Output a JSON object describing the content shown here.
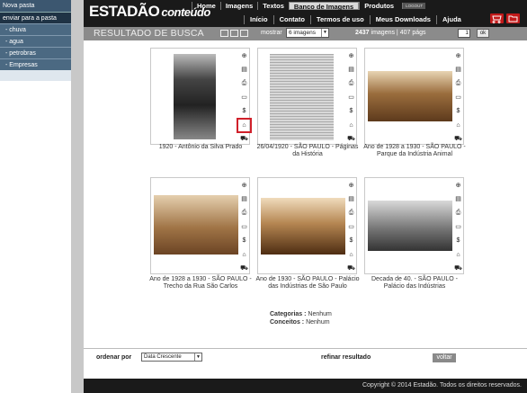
{
  "sidebar": {
    "items": [
      {
        "label": "Nova pasta"
      },
      {
        "label": "enviar para a pasta"
      },
      {
        "label": "- chuva"
      },
      {
        "label": "- agua"
      },
      {
        "label": "- petrobras"
      },
      {
        "label": "- Empresas"
      }
    ]
  },
  "header": {
    "logo": "ESTADÃO",
    "logo_sub": "conteúdo",
    "nav_top": [
      "Home",
      "Imagens",
      "Textos",
      "Banco de Imagens",
      "Produtos"
    ],
    "logout": "LOGOUT",
    "nav_bottom": [
      "Início",
      "Contato",
      "Termos de uso",
      "Meus Downloads",
      "Ajuda"
    ]
  },
  "toolbar": {
    "title": "RESULTADO DE BUSCA",
    "mostrar_label": "mostrar",
    "mostrar_value": "6 imagens",
    "count": "2437",
    "count_suffix": "imagens | 407 págs",
    "page": "1",
    "ok": "ok"
  },
  "results": [
    {
      "caption": "1920 - Antônio da Silva Prado"
    },
    {
      "caption": "26/04/1920 - SÃO PAULO - Páginas da História"
    },
    {
      "caption": "Ano de 1928 a 1930 - SÃO PAULO - Parque da Indústria Animal"
    },
    {
      "caption": "Ano de 1928 a 1930 - SÃO PAULO - Trecho da Rua São Carlos"
    },
    {
      "caption": "Ano de 1930 - SÃO PAULO - Palácio das Indústrias de São Paulo"
    },
    {
      "caption": "Decada de 40. - SÃO PAULO - Palácio das Indústrias"
    }
  ],
  "actions": [
    "zoom-icon",
    "document-icon",
    "print-icon",
    "card-icon",
    "dollar-icon",
    "folder-icon",
    "cart-icon"
  ],
  "meta": {
    "categorias_label": "Categorias :",
    "categorias_value": "Nenhum",
    "conceitos_label": "Conceitos :",
    "conceitos_value": "Nenhum"
  },
  "bottom": {
    "ordenar_label": "ordenar por",
    "ordenar_value": "Data Crescente",
    "refinar": "refinar resultado",
    "voltar": "voltar"
  },
  "footer": {
    "copyright": "Copyright © 2014 Estadão. Todos os direitos reservados."
  },
  "colors": {
    "header": "#1a1a1a",
    "toolbar": "#8b8b8b",
    "sidebar": "#3c5770",
    "accent": "#c21a1a"
  }
}
